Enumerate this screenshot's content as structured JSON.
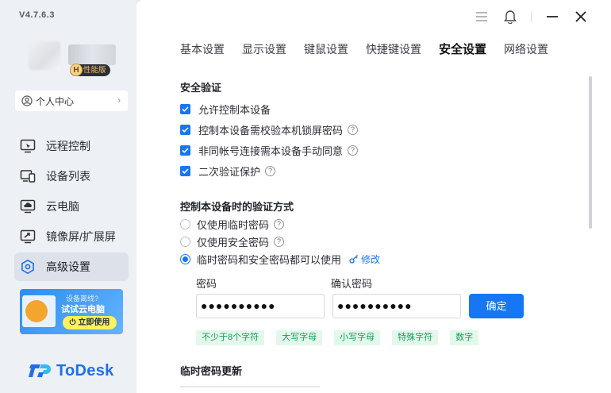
{
  "app": {
    "version": "V4.7.6.3",
    "edition_badge": "性能版",
    "edition_letter": "H",
    "brand": "ToDesk"
  },
  "sidebar": {
    "personal_center": "个人中心",
    "items": [
      {
        "label": "远程控制",
        "icon": "remote-control-icon",
        "active": false
      },
      {
        "label": "设备列表",
        "icon": "device-list-icon",
        "active": false
      },
      {
        "label": "云电脑",
        "icon": "cloud-pc-icon",
        "active": false
      },
      {
        "label": "镜像屏/扩展屏",
        "icon": "mirror-screen-icon",
        "active": false
      },
      {
        "label": "高级设置",
        "icon": "advanced-settings-icon",
        "active": true
      }
    ],
    "promo": {
      "line1": "设备离线?",
      "line2": "试试云电脑",
      "button": "立即使用"
    }
  },
  "tabs": [
    "基本设置",
    "显示设置",
    "键鼠设置",
    "快捷键设置",
    "安全设置",
    "网络设置"
  ],
  "active_tab": "安全设置",
  "security": {
    "title": "安全验证",
    "options": [
      {
        "label": "允许控制本设备",
        "checked": true,
        "help": false
      },
      {
        "label": "控制本设备需校验本机锁屏密码",
        "checked": true,
        "help": true
      },
      {
        "label": "非同帐号连接需本设备手动同意",
        "checked": true,
        "help": true
      },
      {
        "label": "二次验证保护",
        "checked": true,
        "help": true
      }
    ]
  },
  "verify": {
    "title": "控制本设备时的验证方式",
    "options": [
      {
        "label": "仅使用临时密码",
        "selected": false
      },
      {
        "label": "仅使用安全密码",
        "selected": false
      },
      {
        "label": "临时密码和安全密码都可以使用",
        "selected": true
      }
    ],
    "modify": "修改"
  },
  "password": {
    "label": "密码",
    "confirm_label": "确认密码",
    "value": "●●●●●●●●●●",
    "confirm_value": "●●●●●●●●●●",
    "confirm_button": "确定",
    "rules": [
      "不少于8个字符",
      "大写字母",
      "小写字母",
      "特殊字符",
      "数字"
    ]
  },
  "temp_password": {
    "title": "临时密码更新"
  },
  "colors": {
    "accent": "#1676f3",
    "rule_bg": "#e4f7ec",
    "rule_text": "#15a05a"
  }
}
